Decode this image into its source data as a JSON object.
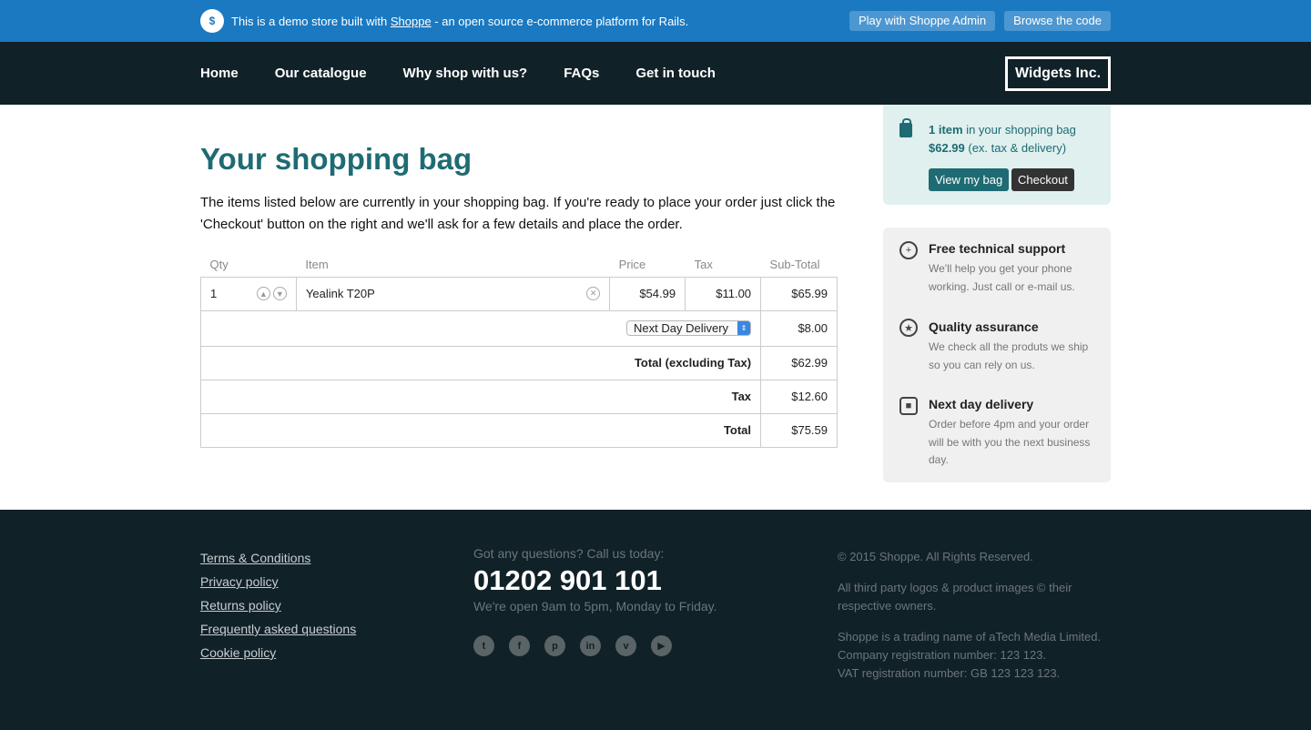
{
  "banner": {
    "logo": "$",
    "text_before": "This is a demo store built with ",
    "link": "Shoppe",
    "text_after": " - an open source e-commerce platform for Rails.",
    "buttons": [
      "Play with Shoppe Admin",
      "Browse the code"
    ]
  },
  "nav": {
    "links": [
      "Home",
      "Our catalogue",
      "Why shop with us?",
      "FAQs",
      "Get in touch"
    ],
    "brand": "Widgets Inc."
  },
  "main": {
    "title": "Your shopping bag",
    "intro": "The items listed below are currently in your shopping bag. If you're ready to place your order just click the 'Checkout' button on the right and we'll ask for a few details and place the order."
  },
  "table": {
    "headers": {
      "qty": "Qty",
      "item": "Item",
      "price": "Price",
      "tax": "Tax",
      "subtotal": "Sub-Total"
    },
    "row": {
      "qty": "1",
      "item": "Yealink T20P",
      "price": "$54.99",
      "tax": "$11.00",
      "subtotal": "$65.99"
    },
    "delivery": {
      "selected": "Next Day Delivery",
      "amount": "$8.00"
    },
    "total_ex_tax": {
      "label": "Total (excluding Tax)",
      "amount": "$62.99"
    },
    "tax": {
      "label": "Tax",
      "amount": "$12.60"
    },
    "total": {
      "label": "Total",
      "amount": "$75.59"
    }
  },
  "basket": {
    "count": "1 item",
    "count_suffix": " in your shopping bag",
    "price": "$62.99",
    "price_suffix": " (ex. tax & delivery)",
    "view": "View my bag",
    "checkout": "Checkout"
  },
  "usps": [
    {
      "title": "Free technical support",
      "text": "We'll help you get your phone working. Just call or e-mail us.",
      "icon": "lifebuoy-icon"
    },
    {
      "title": "Quality assurance",
      "text": "We check all the produts we ship so you can rely on us.",
      "icon": "award-icon"
    },
    {
      "title": "Next day delivery",
      "text": "Order before 4pm and your order will be with you the next business day.",
      "icon": "bus-icon"
    }
  ],
  "footer": {
    "links": [
      "Terms & Conditions",
      "Privacy policy",
      "Returns policy",
      "Frequently asked questions",
      "Cookie policy"
    ],
    "question": "Got any questions? Call us today:",
    "phone": "01202 901 101",
    "hours": "We're open 9am to 5pm, Monday to Friday.",
    "social": [
      "twitter-icon",
      "facebook-icon",
      "pinterest-icon",
      "linkedin-icon",
      "vimeo-icon",
      "youtube-icon"
    ],
    "copyright": "© 2015 Shoppe. All Rights Reserved.",
    "logos": "All third party logos & product images © their respective owners.",
    "trading": "Shoppe is a trading name of aTech Media Limited.",
    "company_reg": "Company registration number: 123 123.",
    "vat": "VAT registration number: GB 123 123 123."
  }
}
